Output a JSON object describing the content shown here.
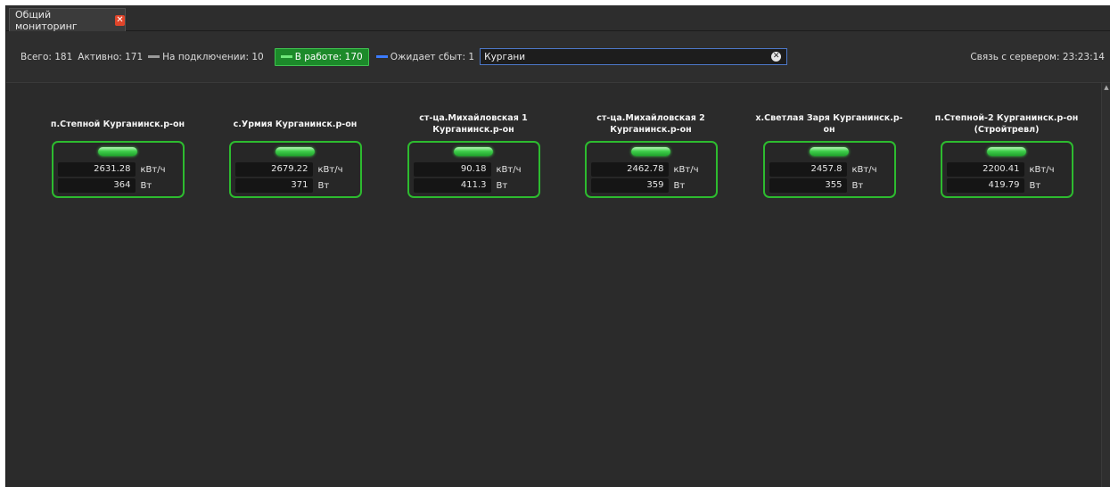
{
  "tab": {
    "title": "Общий мониторинг",
    "close_glyph": "✕"
  },
  "toolbar": {
    "total": "Всего: 181",
    "active": "Активно: 171",
    "connecting": "На подключении: 10",
    "working": "В работе: 170",
    "waiting": "Ожидает сбыт: 1",
    "search_value": "Кургани",
    "server_status": "Связь с сервером: 23:23:14"
  },
  "colors": {
    "connecting": "#9a9a9a",
    "working": "#3fd14d",
    "waiting": "#3b7bff",
    "card_border": "#2dbb2f"
  },
  "stations": [
    {
      "name": "п.Степной Курганинск.р-он",
      "energy": "2631.28",
      "energy_unit": "кВт/ч",
      "power": "364",
      "power_unit": "Вт"
    },
    {
      "name": "с.Урмия Курганинск.р-он",
      "energy": "2679.22",
      "energy_unit": "кВт/ч",
      "power": "371",
      "power_unit": "Вт"
    },
    {
      "name": "ст-ца.Михайловская 1 Курганинск.р-он",
      "energy": "90.18",
      "energy_unit": "кВт/ч",
      "power": "411.3",
      "power_unit": "Вт"
    },
    {
      "name": "ст-ца.Михайловская 2 Курганинск.р-он",
      "energy": "2462.78",
      "energy_unit": "кВт/ч",
      "power": "359",
      "power_unit": "Вт"
    },
    {
      "name": "х.Светлая Заря Курганинск.р-он",
      "energy": "2457.8",
      "energy_unit": "кВт/ч",
      "power": "355",
      "power_unit": "Вт"
    },
    {
      "name": "п.Степной-2 Курганинск.р-он (Стройтревл)",
      "energy": "2200.41",
      "energy_unit": "кВт/ч",
      "power": "419.79",
      "power_unit": "Вт"
    }
  ],
  "icons": {
    "tab_close": "close-icon",
    "search_clear": "clear-icon",
    "status_indicator": "status-led-icon",
    "scroll_up": "scroll-up-arrow-icon"
  }
}
